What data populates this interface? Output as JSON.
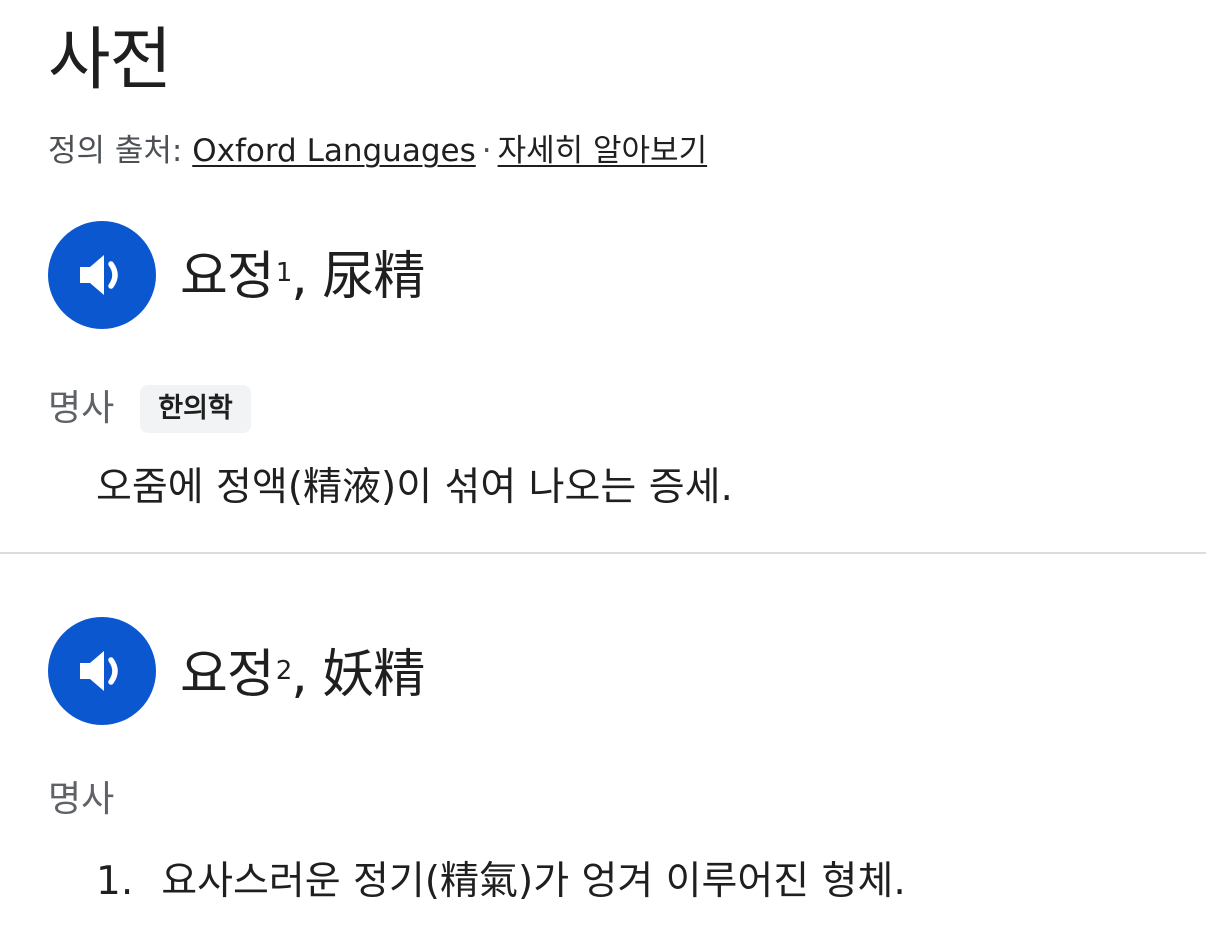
{
  "header": {
    "title": "사전",
    "source_prefix": "정의 출처: ",
    "source_link": "Oxford Languages",
    "separator": "·",
    "learn_more": "자세히 알아보기"
  },
  "entries": [
    {
      "word": "요정",
      "sup": "1",
      "hanja": ", 尿精",
      "pos": "명사",
      "tag": "한의학",
      "definitions": [
        "오줌에 정액(精液)이 섞여 나오는 증세."
      ]
    },
    {
      "word": "요정",
      "sup": "2",
      "hanja": ", 妖精",
      "pos": "명사",
      "definitions": [
        {
          "num": "1.",
          "text": "요사스러운 정기(精氣)가 엉겨 이루어진 형체."
        }
      ]
    }
  ],
  "colors": {
    "speaker_button": "#0b57d0",
    "divider": "#dadce0",
    "tag_bg": "#f1f3f4"
  },
  "icons": {
    "speaker": "speaker-icon"
  }
}
